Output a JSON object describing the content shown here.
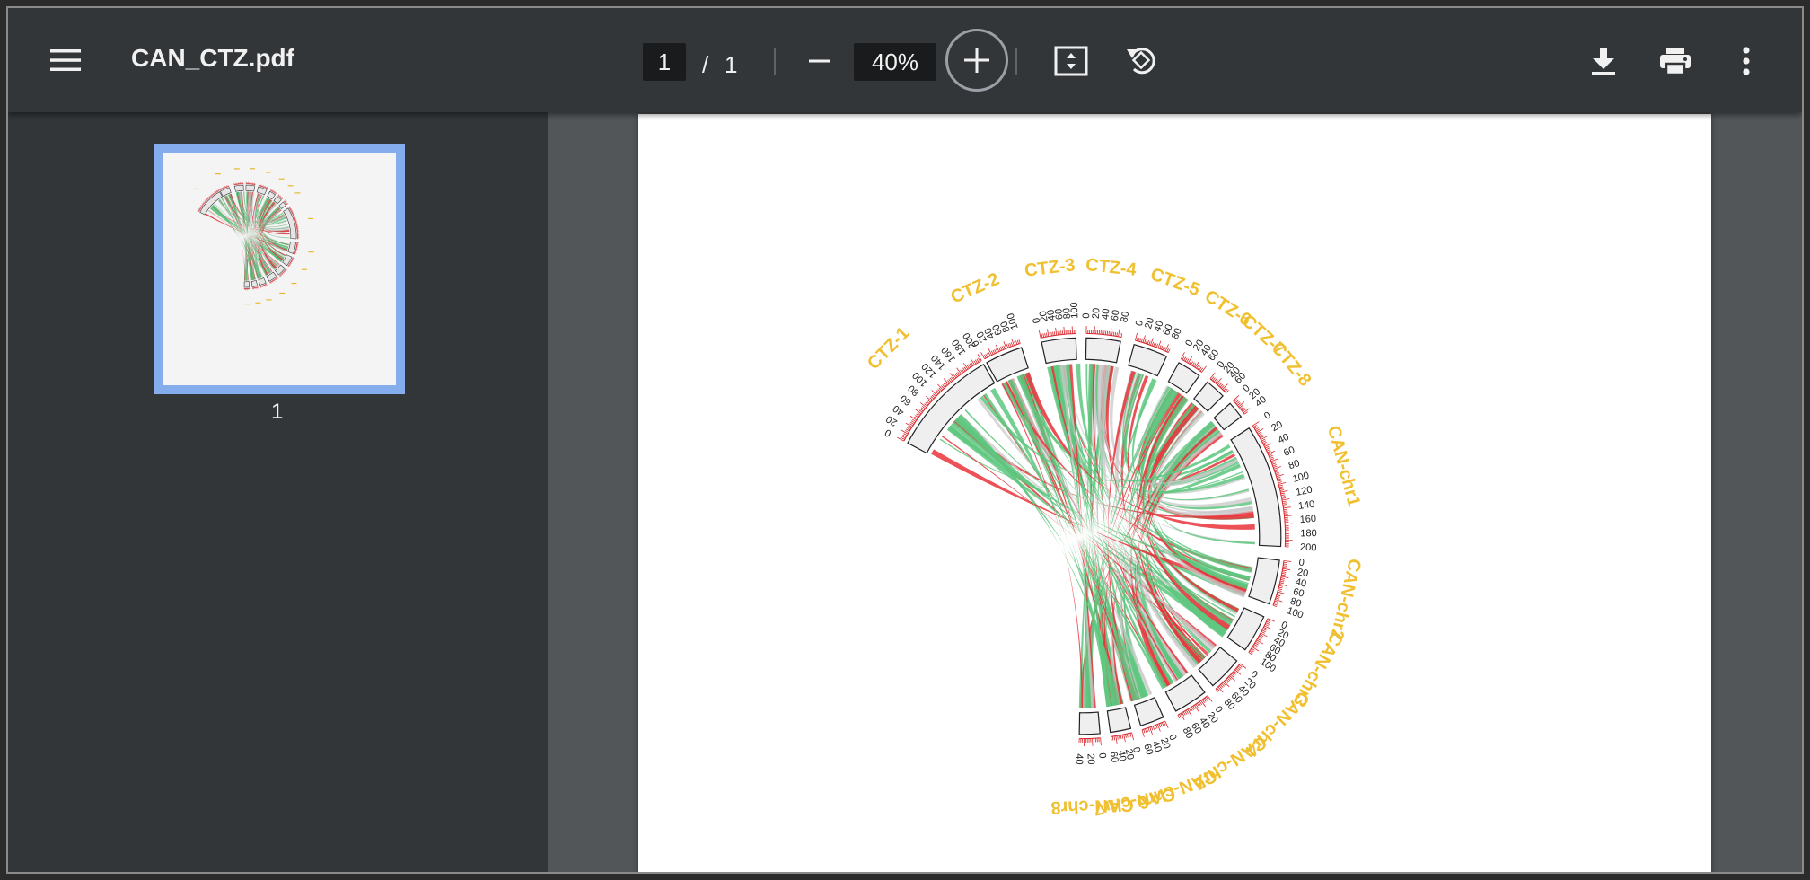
{
  "toolbar": {
    "file_name": "CAN_CTZ.pdf",
    "current_page": "1",
    "page_separator": "/",
    "total_pages": "1",
    "zoom": "40%"
  },
  "sidebar": {
    "thumbnails": [
      {
        "label": "1"
      }
    ]
  },
  "icons": {
    "menu": "hamburger-menu-icon",
    "zoom_out": "minus-icon",
    "zoom_in": "plus-icon",
    "fit": "fit-to-page-icon",
    "rotate": "rotate-counterclockwise-icon",
    "download": "download-icon",
    "print": "print-icon",
    "more": "more-vertical-icon"
  },
  "colors": {
    "toolbar_bg": "#323639",
    "viewer_bg": "#525659",
    "thumb_highlight": "#8ab4f8",
    "label_color": "#f0c030",
    "link_green": "#5ec77f",
    "link_red": "#ea333b",
    "link_gray": "#c8c8c8",
    "tick_red": "#d9262b"
  },
  "document": {
    "chart_type": "circos",
    "segments": [
      {
        "name": "CTZ-1",
        "ticks": [
          "0",
          "20",
          "40",
          "60",
          "80",
          "100",
          "120",
          "140",
          "160",
          "180",
          "200"
        ]
      },
      {
        "name": "CTZ-2",
        "ticks": [
          "0",
          "20",
          "40",
          "60",
          "80",
          "100"
        ]
      },
      {
        "name": "CTZ-3",
        "ticks": [
          "0",
          "20",
          "40",
          "60",
          "80",
          "100"
        ]
      },
      {
        "name": "CTZ-4",
        "ticks": [
          "0",
          "20",
          "40",
          "60",
          "80"
        ]
      },
      {
        "name": "CTZ-5",
        "ticks": [
          "0",
          "20",
          "40",
          "60",
          "80"
        ]
      },
      {
        "name": "CTZ-6",
        "ticks": [
          "0",
          "20",
          "40",
          "60"
        ]
      },
      {
        "name": "CTZ-7",
        "ticks": [
          "0",
          "20",
          "40",
          "60"
        ]
      },
      {
        "name": "CTZ-8",
        "ticks": [
          "0",
          "20",
          "40"
        ]
      },
      {
        "name": "CAN-chr1",
        "ticks": [
          "0",
          "20",
          "40",
          "60",
          "80",
          "100",
          "120",
          "140",
          "160",
          "180",
          "200"
        ]
      },
      {
        "name": "CAN-chr2",
        "ticks": [
          "0",
          "20",
          "40",
          "60",
          "80",
          "100"
        ]
      },
      {
        "name": "CAN-chr3",
        "ticks": [
          "0",
          "20",
          "40",
          "60",
          "80",
          "100"
        ]
      },
      {
        "name": "CAN-chr4",
        "ticks": [
          "0",
          "20",
          "40",
          "60",
          "80"
        ]
      },
      {
        "name": "CAN-chr5",
        "ticks": [
          "0",
          "20",
          "40",
          "60",
          "80"
        ]
      },
      {
        "name": "CAN-chr6",
        "ticks": [
          "0",
          "20",
          "40",
          "60"
        ]
      },
      {
        "name": "CAN-chr7",
        "ticks": [
          "0",
          "20",
          "40",
          "60"
        ]
      },
      {
        "name": "CAN-chr8",
        "ticks": [
          "0",
          "20",
          "40"
        ]
      }
    ]
  }
}
